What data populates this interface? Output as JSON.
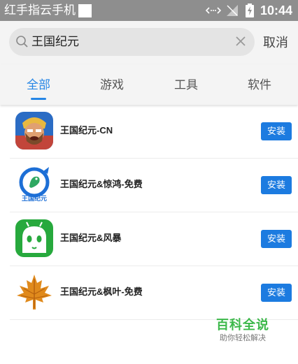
{
  "status_bar": {
    "carrier": "红手指云手机",
    "time": "10:44",
    "icons": [
      "data-arrows-icon",
      "signal-icon",
      "battery-charging-icon"
    ]
  },
  "search": {
    "query": "王国纪元",
    "cancel_label": "取消"
  },
  "tabs": {
    "active": "全部",
    "items": [
      "全部",
      "游戏",
      "工具",
      "软件"
    ]
  },
  "apps": [
    {
      "name": "王国纪元-CN",
      "install_label": "安装",
      "icon": "warrior-game-icon"
    },
    {
      "name": "王国纪元&惊鸿-免费",
      "install_label": "安装",
      "icon": "bird-logo-icon",
      "icon_text": "王国纪元"
    },
    {
      "name": "王国纪元&风暴",
      "install_label": "安装",
      "icon": "android-robot-icon"
    },
    {
      "name": "王国纪元&枫叶-免费",
      "install_label": "安装",
      "icon": "maple-leaf-icon"
    }
  ],
  "watermark": {
    "title": "百科全说",
    "subtitle": "助你轻松解决"
  },
  "colors": {
    "accent": "#2686e6",
    "install_button": "#1c7be0",
    "status_bar": "#8e8e8e",
    "watermark": "#3cb84a"
  }
}
